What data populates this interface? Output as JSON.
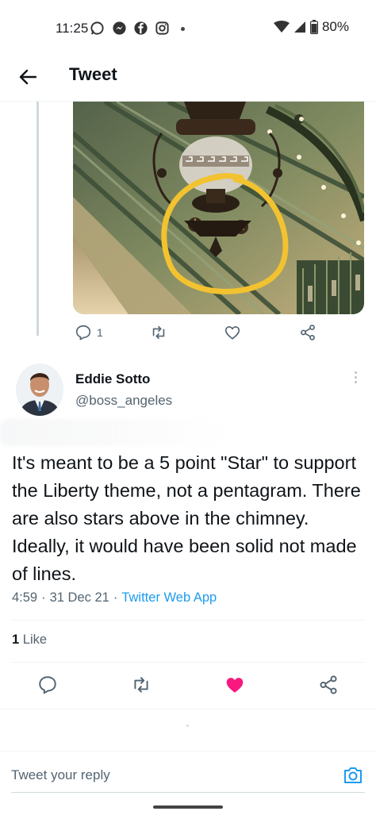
{
  "status_bar": {
    "time": "11:25",
    "battery": "80%",
    "notification_icons": [
      "whatsapp-icon",
      "messenger-icon",
      "facebook-icon",
      "instagram-icon",
      "dot-icon"
    ],
    "system_icons": [
      "wifi-icon",
      "signal-icon",
      "battery-icon"
    ]
  },
  "header": {
    "title": "Tweet"
  },
  "prev_tweet": {
    "reply_count": "1"
  },
  "tweet": {
    "author_name": "Eddie Sotto",
    "author_handle": "@boss_angeles",
    "text": "It's meant to be a 5 point \"Star\" to support the Liberty theme, not a pentagram. There are also stars above in the chimney. Ideally, it would have been solid not made of lines.",
    "time": "4:59",
    "date": "31 Dec 21",
    "separator": "·",
    "source": "Twitter Web App",
    "like_count": "1",
    "like_label": "Like"
  },
  "reply": {
    "placeholder": "Tweet your reply"
  },
  "colors": {
    "accent": "#1d9bf0",
    "like": "#f91880",
    "muted": "#536471",
    "annotation": "#f2c230"
  }
}
